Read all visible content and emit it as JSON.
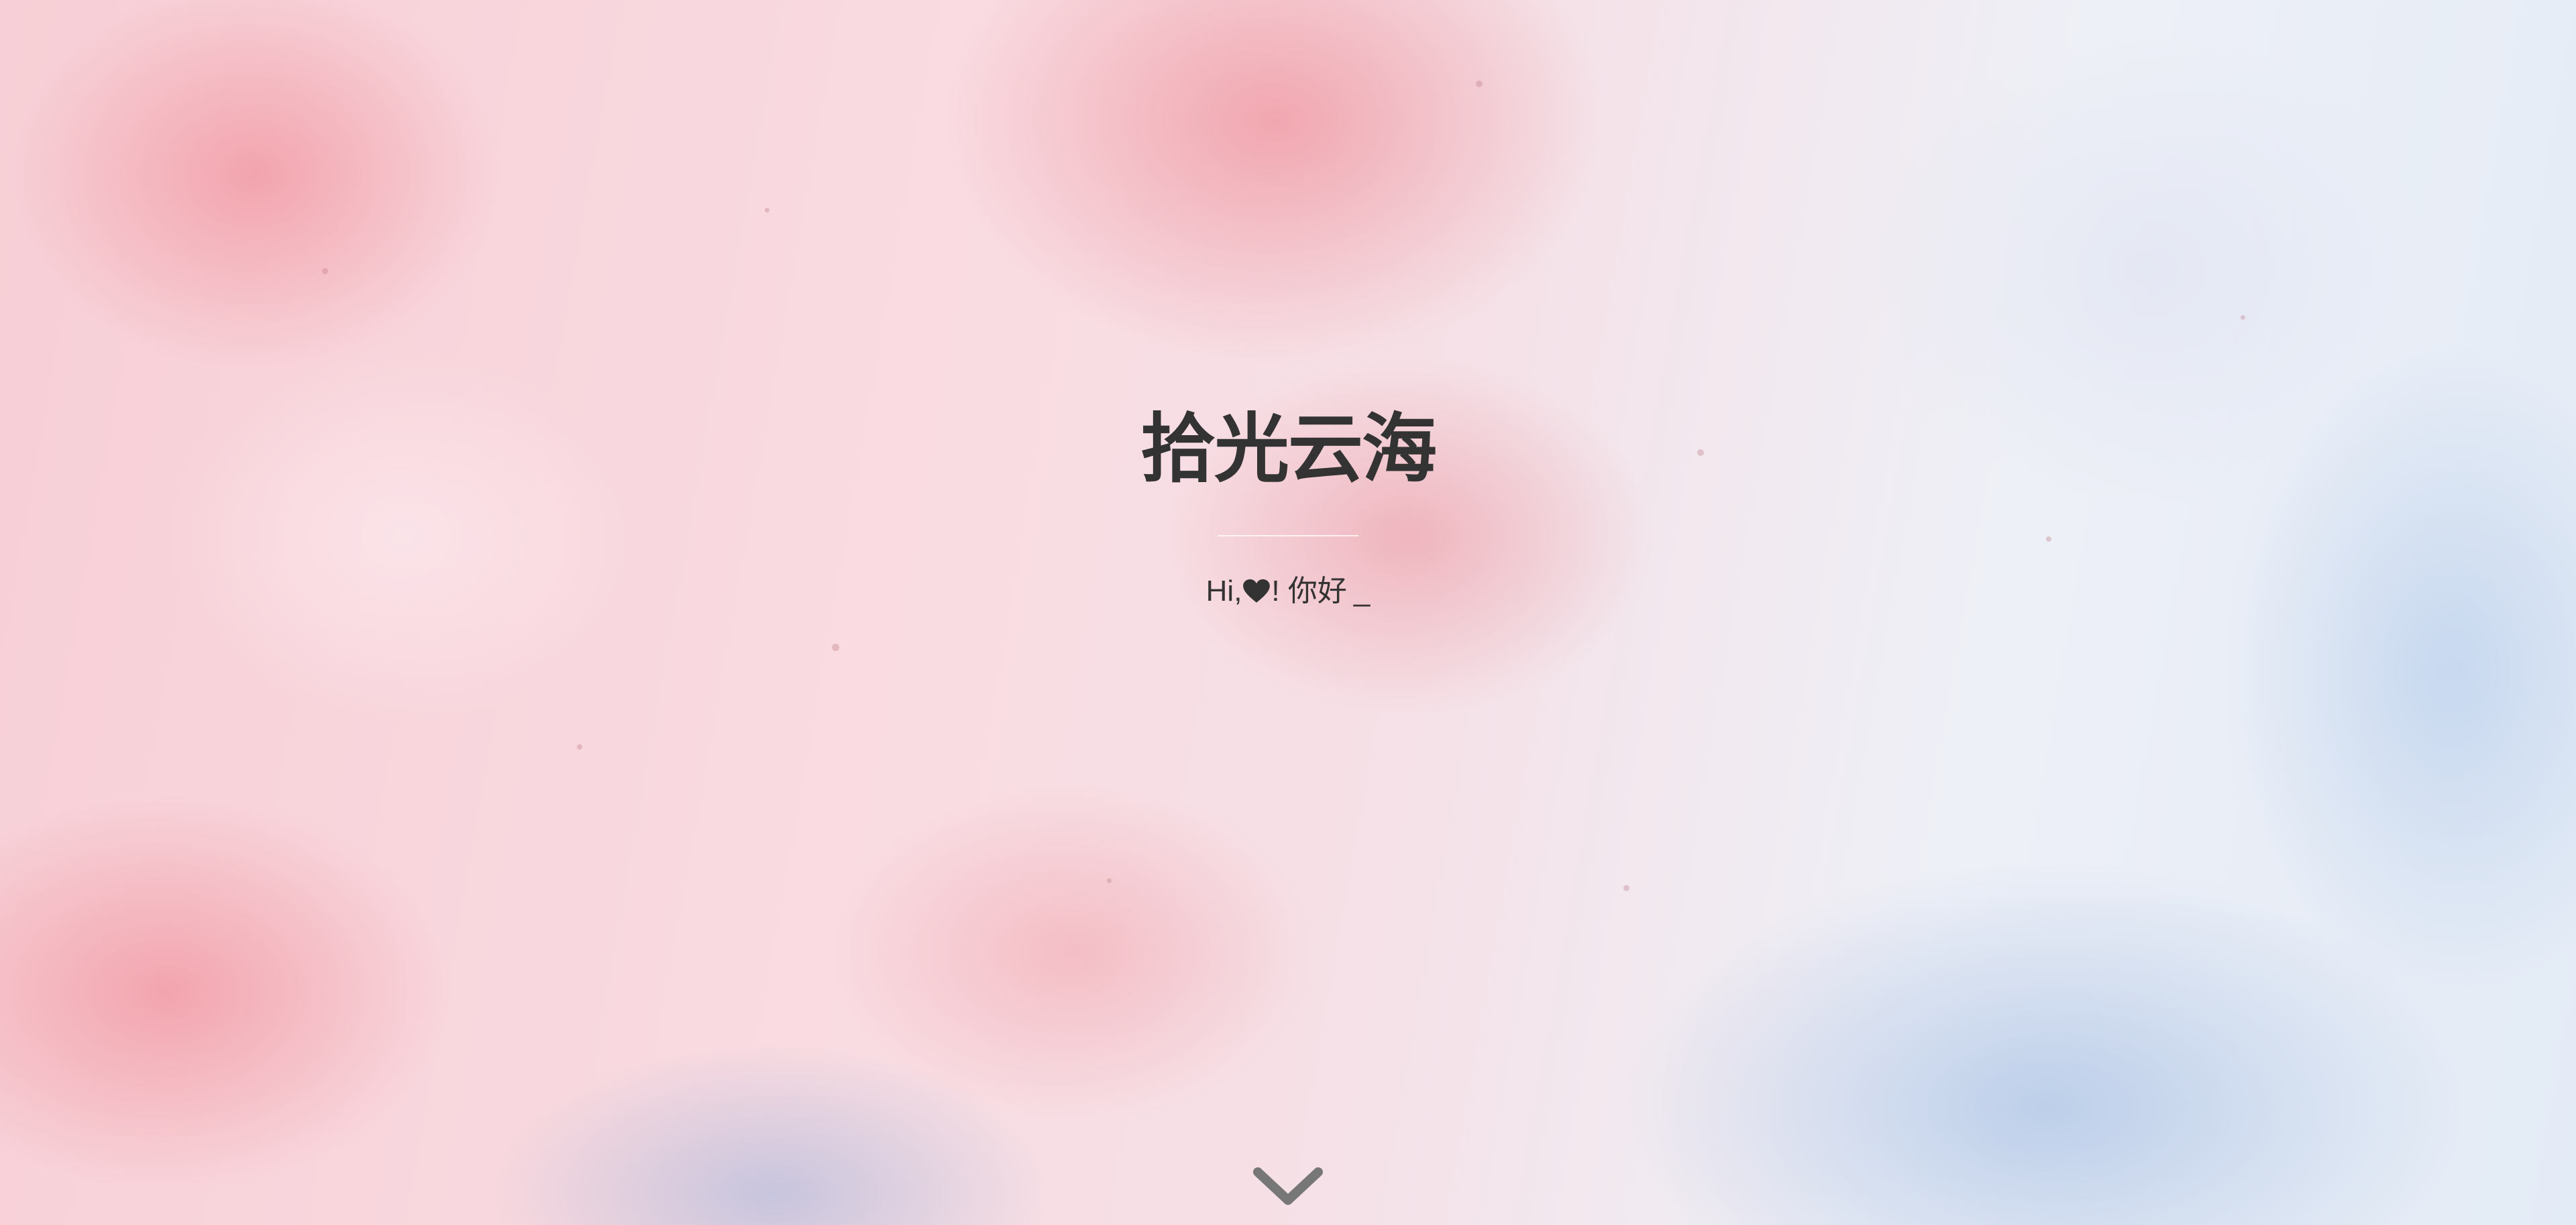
{
  "hero": {
    "title": "拾光云海",
    "greeting_prefix": "Hi,",
    "heart_icon": "heart-icon",
    "greeting_suffix": "! 你好",
    "cursor": "_"
  },
  "scroll": {
    "icon": "chevron-down-icon"
  },
  "colors": {
    "text": "#333333",
    "icon": "#777777"
  }
}
